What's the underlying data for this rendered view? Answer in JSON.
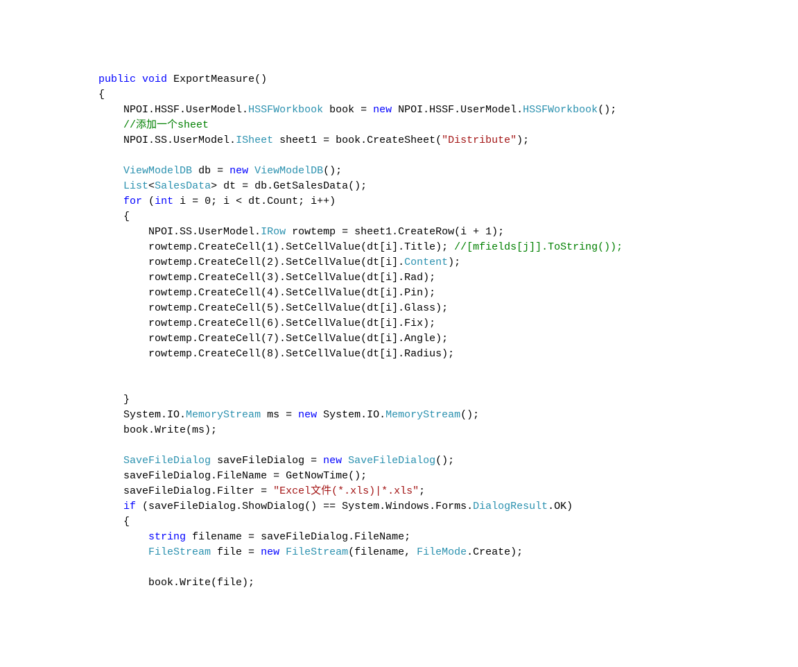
{
  "code": {
    "lines": [
      {
        "indent": 2,
        "tokens": [
          {
            "t": "public",
            "c": "k"
          },
          {
            "t": " "
          },
          {
            "t": "void",
            "c": "k"
          },
          {
            "t": " ExportMeasure()"
          }
        ]
      },
      {
        "indent": 2,
        "tokens": [
          {
            "t": "{"
          }
        ]
      },
      {
        "indent": 3,
        "tokens": [
          {
            "t": "NPOI.HSSF.UserModel."
          },
          {
            "t": "HSSFWorkbook",
            "c": "ty"
          },
          {
            "t": " book = "
          },
          {
            "t": "new",
            "c": "k"
          },
          {
            "t": " NPOI.HSSF.UserModel."
          },
          {
            "t": "HSSFWorkbook",
            "c": "ty"
          },
          {
            "t": "();"
          }
        ]
      },
      {
        "indent": 3,
        "tokens": [
          {
            "t": "//添加一个sheet",
            "c": "c"
          }
        ]
      },
      {
        "indent": 3,
        "tokens": [
          {
            "t": "NPOI.SS.UserModel."
          },
          {
            "t": "ISheet",
            "c": "ty"
          },
          {
            "t": " sheet1 = book.CreateSheet("
          },
          {
            "t": "\"Distribute\"",
            "c": "s"
          },
          {
            "t": ");"
          }
        ]
      },
      {
        "indent": 0,
        "tokens": [
          {
            "t": ""
          }
        ]
      },
      {
        "indent": 3,
        "tokens": [
          {
            "t": "ViewModelDB",
            "c": "ty"
          },
          {
            "t": " db = "
          },
          {
            "t": "new",
            "c": "k"
          },
          {
            "t": " "
          },
          {
            "t": "ViewModelDB",
            "c": "ty"
          },
          {
            "t": "();"
          }
        ]
      },
      {
        "indent": 3,
        "tokens": [
          {
            "t": "List",
            "c": "ty"
          },
          {
            "t": "<"
          },
          {
            "t": "SalesData",
            "c": "ty"
          },
          {
            "t": "> dt = db.GetSalesData();"
          }
        ]
      },
      {
        "indent": 3,
        "tokens": [
          {
            "t": "for",
            "c": "k"
          },
          {
            "t": " ("
          },
          {
            "t": "int",
            "c": "k"
          },
          {
            "t": " i = 0; i < dt.Count; i++)"
          }
        ]
      },
      {
        "indent": 3,
        "tokens": [
          {
            "t": "{"
          }
        ]
      },
      {
        "indent": 4,
        "tokens": [
          {
            "t": "NPOI.SS.UserModel."
          },
          {
            "t": "IRow",
            "c": "ty"
          },
          {
            "t": " rowtemp = sheet1.CreateRow(i + 1);"
          }
        ]
      },
      {
        "indent": 4,
        "tokens": [
          {
            "t": "rowtemp.CreateCell(1).SetCellValue(dt[i].Title); "
          },
          {
            "t": "//[mfields[j]].ToString());",
            "c": "c"
          }
        ]
      },
      {
        "indent": 4,
        "tokens": [
          {
            "t": "rowtemp.CreateCell(2).SetCellValue(dt[i]."
          },
          {
            "t": "Content",
            "c": "ty"
          },
          {
            "t": ");"
          }
        ]
      },
      {
        "indent": 4,
        "tokens": [
          {
            "t": "rowtemp.CreateCell(3).SetCellValue(dt[i].Rad);"
          }
        ]
      },
      {
        "indent": 4,
        "tokens": [
          {
            "t": "rowtemp.CreateCell(4).SetCellValue(dt[i].Pin);"
          }
        ]
      },
      {
        "indent": 4,
        "tokens": [
          {
            "t": "rowtemp.CreateCell(5).SetCellValue(dt[i].Glass);"
          }
        ]
      },
      {
        "indent": 4,
        "tokens": [
          {
            "t": "rowtemp.CreateCell(6).SetCellValue(dt[i].Fix);"
          }
        ]
      },
      {
        "indent": 4,
        "tokens": [
          {
            "t": "rowtemp.CreateCell(7).SetCellValue(dt[i].Angle);"
          }
        ]
      },
      {
        "indent": 4,
        "tokens": [
          {
            "t": "rowtemp.CreateCell(8).SetCellValue(dt[i].Radius);"
          }
        ]
      },
      {
        "indent": 0,
        "tokens": [
          {
            "t": ""
          }
        ]
      },
      {
        "indent": 0,
        "tokens": [
          {
            "t": ""
          }
        ]
      },
      {
        "indent": 3,
        "tokens": [
          {
            "t": "}"
          }
        ]
      },
      {
        "indent": 3,
        "tokens": [
          {
            "t": "System.IO."
          },
          {
            "t": "MemoryStream",
            "c": "ty"
          },
          {
            "t": " ms = "
          },
          {
            "t": "new",
            "c": "k"
          },
          {
            "t": " System.IO."
          },
          {
            "t": "MemoryStream",
            "c": "ty"
          },
          {
            "t": "();"
          }
        ]
      },
      {
        "indent": 3,
        "tokens": [
          {
            "t": "book.Write(ms);"
          }
        ]
      },
      {
        "indent": 0,
        "tokens": [
          {
            "t": ""
          }
        ]
      },
      {
        "indent": 3,
        "tokens": [
          {
            "t": "SaveFileDialog",
            "c": "ty"
          },
          {
            "t": " saveFileDialog = "
          },
          {
            "t": "new",
            "c": "k"
          },
          {
            "t": " "
          },
          {
            "t": "SaveFileDialog",
            "c": "ty"
          },
          {
            "t": "();"
          }
        ]
      },
      {
        "indent": 3,
        "tokens": [
          {
            "t": "saveFileDialog.FileName = GetNowTime();"
          }
        ]
      },
      {
        "indent": 3,
        "tokens": [
          {
            "t": "saveFileDialog.Filter = "
          },
          {
            "t": "\"Excel文件(*.xls)|*.xls\"",
            "c": "s"
          },
          {
            "t": ";"
          }
        ]
      },
      {
        "indent": 3,
        "tokens": [
          {
            "t": "if",
            "c": "k"
          },
          {
            "t": " (saveFileDialog.ShowDialog() == System.Windows.Forms."
          },
          {
            "t": "DialogResult",
            "c": "ty"
          },
          {
            "t": ".OK)"
          }
        ]
      },
      {
        "indent": 3,
        "tokens": [
          {
            "t": "{"
          }
        ]
      },
      {
        "indent": 4,
        "tokens": [
          {
            "t": "string",
            "c": "k"
          },
          {
            "t": " filename = saveFileDialog.FileName;"
          }
        ]
      },
      {
        "indent": 4,
        "tokens": [
          {
            "t": "FileStream",
            "c": "ty"
          },
          {
            "t": " file = "
          },
          {
            "t": "new",
            "c": "k"
          },
          {
            "t": " "
          },
          {
            "t": "FileStream",
            "c": "ty"
          },
          {
            "t": "(filename, "
          },
          {
            "t": "FileMode",
            "c": "ty"
          },
          {
            "t": ".Create);"
          }
        ]
      },
      {
        "indent": 0,
        "tokens": [
          {
            "t": ""
          }
        ]
      },
      {
        "indent": 4,
        "tokens": [
          {
            "t": "book.Write(file);"
          }
        ]
      }
    ]
  }
}
